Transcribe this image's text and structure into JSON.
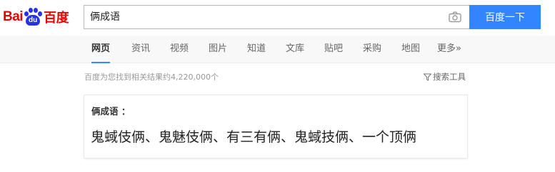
{
  "logo": {
    "left": "Bai",
    "paw": "du",
    "right": "百度"
  },
  "search": {
    "query": "俩成语",
    "button": "百度一下"
  },
  "tabs": [
    {
      "label": "网页",
      "active": true
    },
    {
      "label": "资讯"
    },
    {
      "label": "视频"
    },
    {
      "label": "图片"
    },
    {
      "label": "知道"
    },
    {
      "label": "文库"
    },
    {
      "label": "贴吧"
    },
    {
      "label": "采购"
    },
    {
      "label": "地图"
    },
    {
      "label": "更多»"
    }
  ],
  "results": {
    "stats": "百度为您找到相关结果约4,220,000个",
    "tools": "搜索工具"
  },
  "answer_card": {
    "title": "俩成语 ：",
    "answer": "鬼蜮伎俩、鬼魅伎俩、有三有俩、鬼蜮技俩、一个顶俩"
  },
  "colors": {
    "accent": "#3385ff",
    "brand_red": "#e10602",
    "brand_blue": "#2932e1"
  }
}
